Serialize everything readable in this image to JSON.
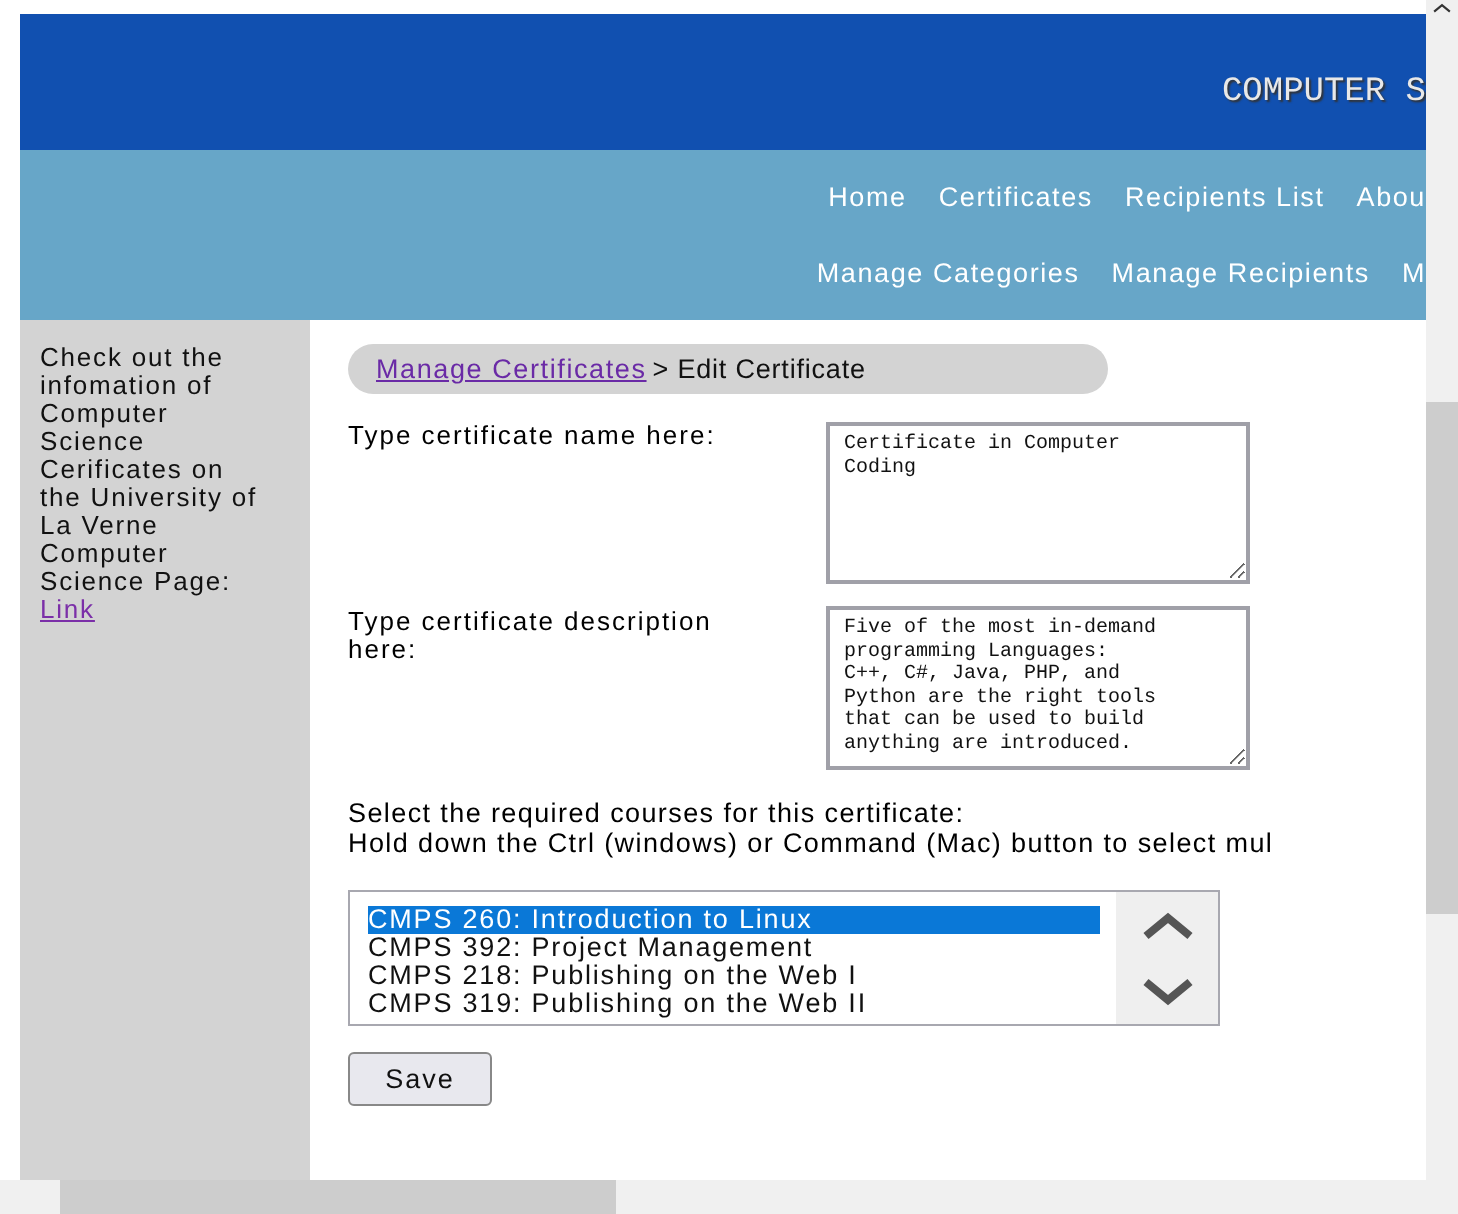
{
  "header": {
    "title": "COMPUTER S"
  },
  "nav": {
    "main_links": [
      "Home",
      "Certificates",
      "Recipients List",
      "Abou"
    ],
    "admin_links": [
      "Manage Categories",
      "Manage Recipients",
      "M"
    ]
  },
  "sidebar": {
    "text": "Check out the infomation of Computer Science Cerificates on the University of La Verne Computer Science Page:",
    "link": "Link"
  },
  "breadcrumb": {
    "link": "Manage Certificates",
    "current": "> Edit Certificate"
  },
  "fields": [
    {
      "label": "Type certificate name here:",
      "value": "Certificate in Computer Coding"
    },
    {
      "label": "Type certificate description here:",
      "value": "Five of the most in-demand programming Languages: C++, C#, Java, PHP, and Python are the right tools that can be used to build anything are introduced."
    }
  ],
  "courses": {
    "instruction": "Select the required courses for this certificate:",
    "hint": "Hold down the Ctrl (windows) or Command (Mac) button to select mul",
    "options": [
      {
        "label": "CMPS 260: Introduction to Linux",
        "selected": true
      },
      {
        "label": "CMPS 392: Project Management",
        "selected": false
      },
      {
        "label": "CMPS 218: Publishing on the Web I",
        "selected": false
      },
      {
        "label": "CMPS 319: Publishing on the Web II",
        "selected": false
      }
    ]
  },
  "save_button": "Save"
}
